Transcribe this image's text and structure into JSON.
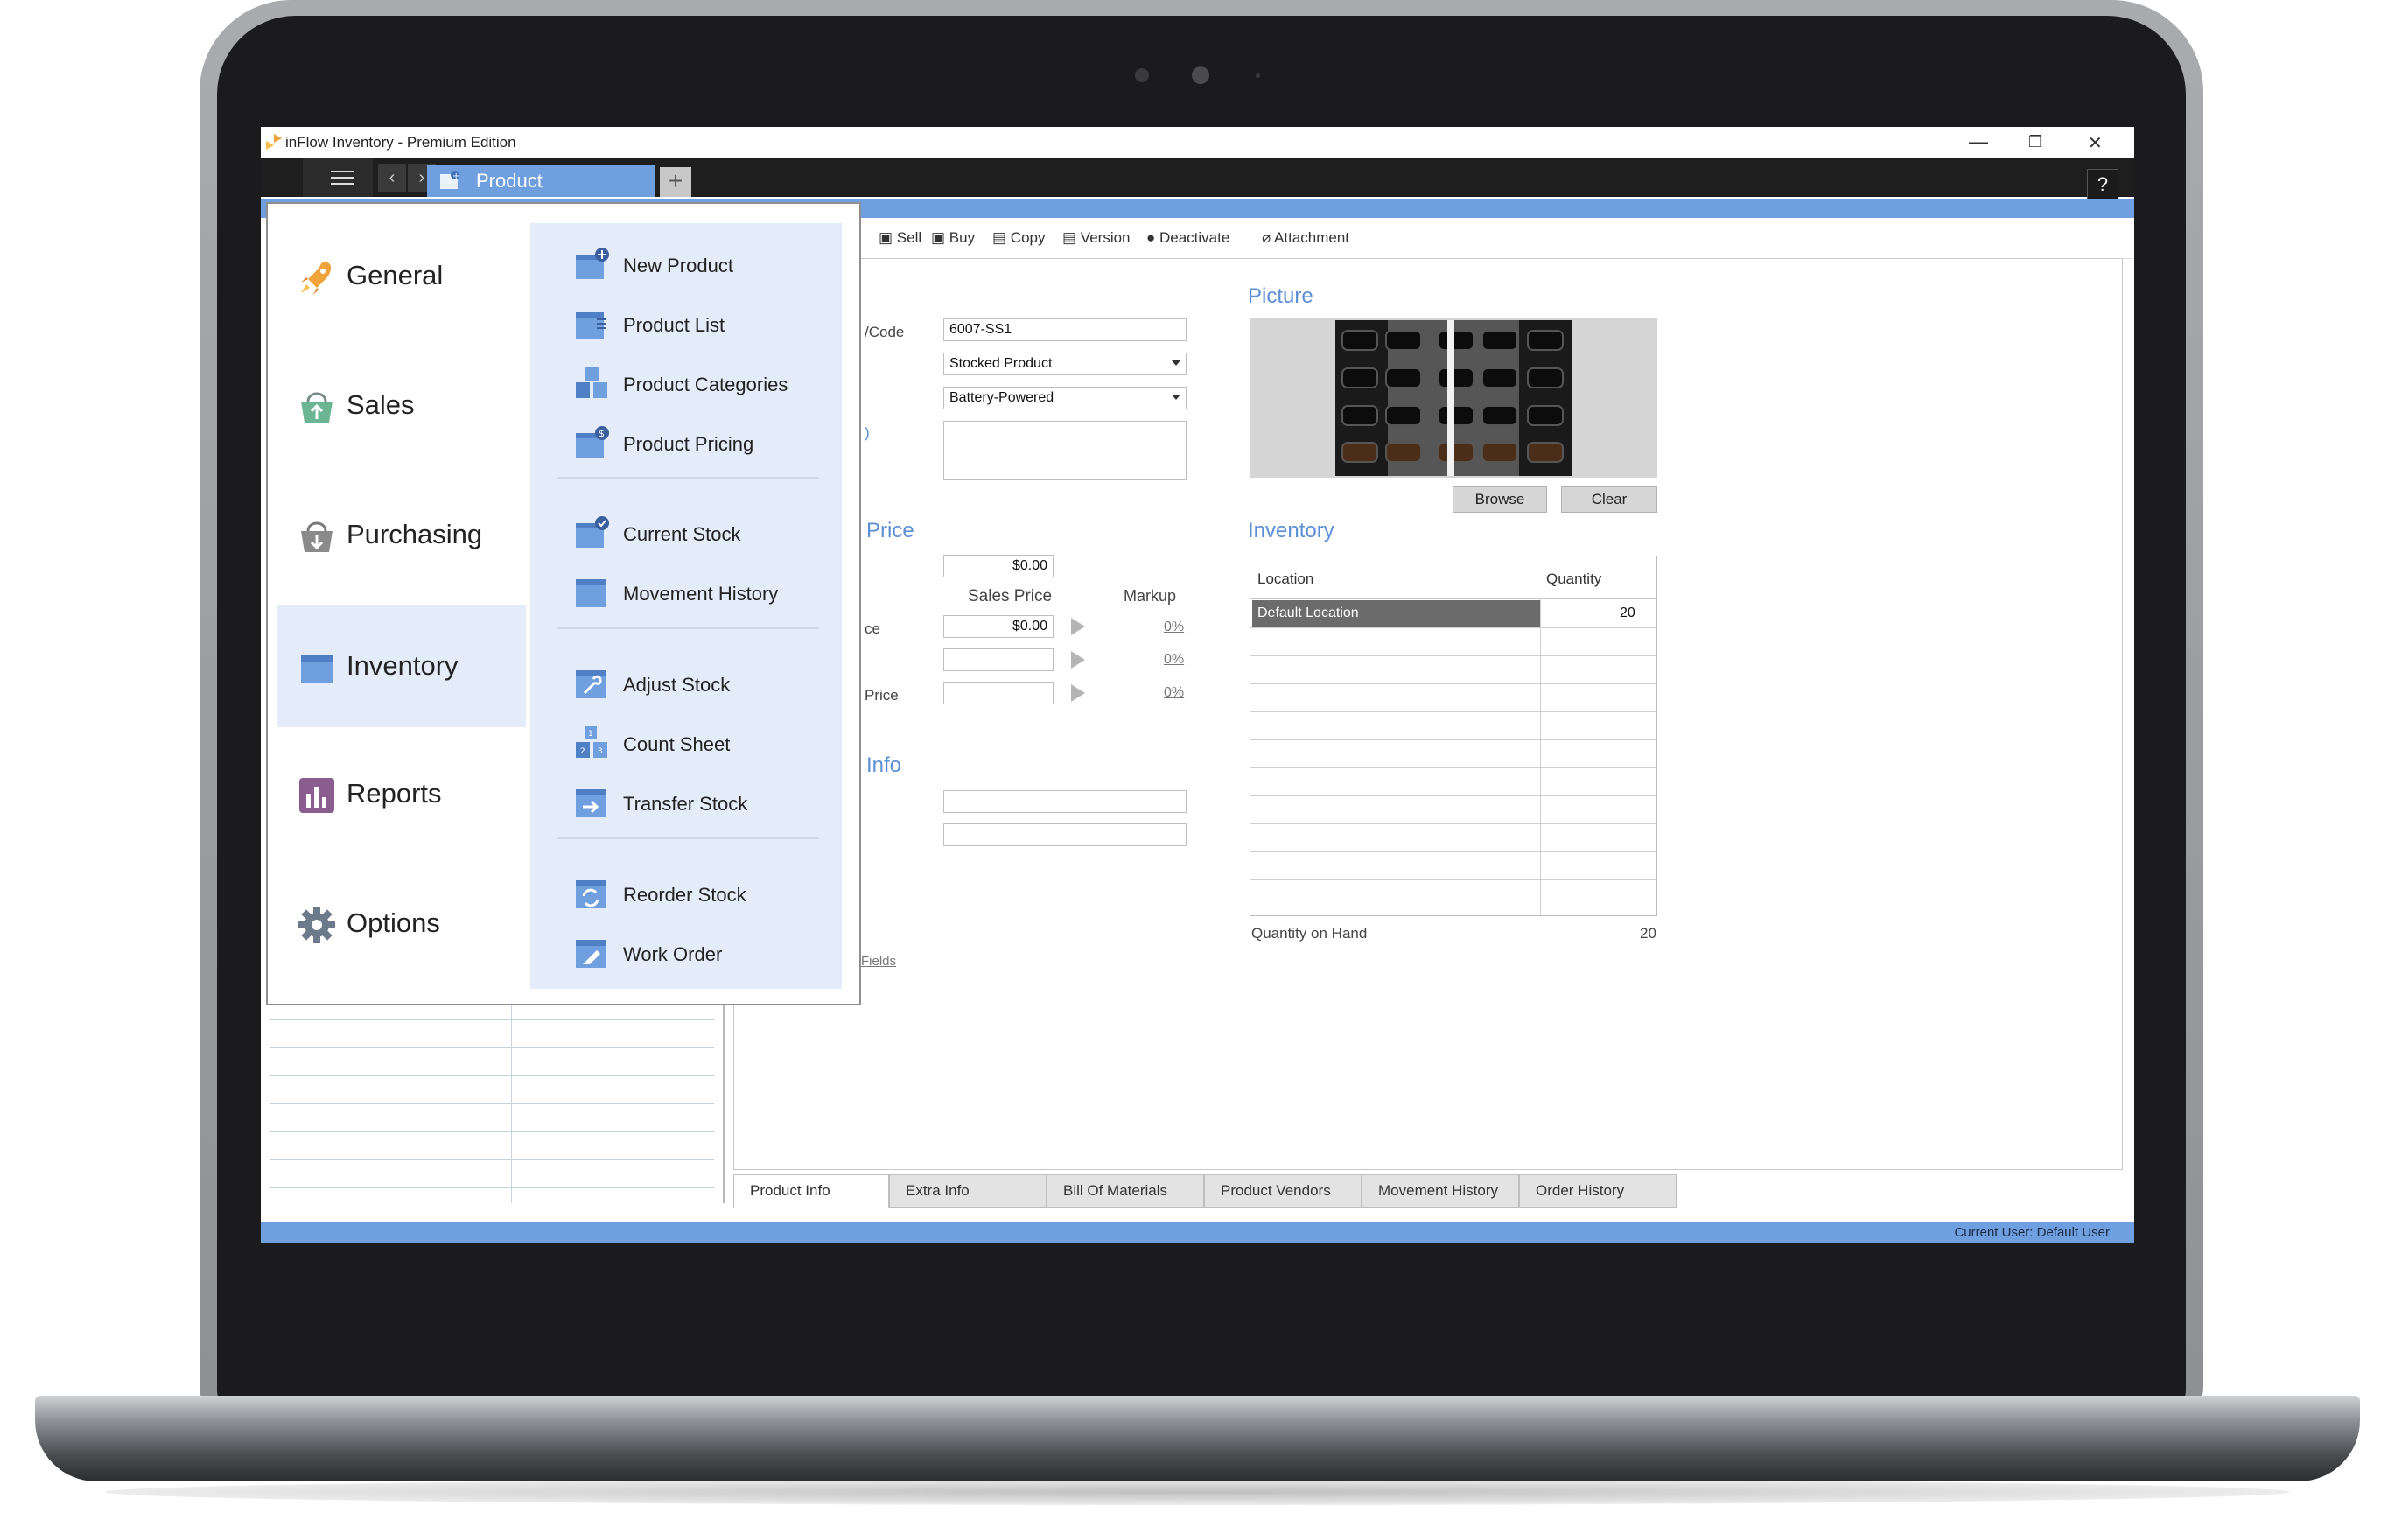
{
  "window": {
    "title": "inFlow Inventory - Premium Edition",
    "minimize": "—",
    "restore": "❐",
    "close": "✕"
  },
  "tabs": {
    "active_tab": "Product",
    "add_tab": "+",
    "help": "?",
    "back": "‹",
    "forward": "›"
  },
  "toolbar": {
    "items": [
      "Sell",
      "Buy",
      "Copy",
      "Version",
      "Deactivate",
      "Attachment"
    ]
  },
  "menu": {
    "categories": [
      {
        "label": "General",
        "icon": "rocket-icon",
        "color": "#f0a33a"
      },
      {
        "label": "Sales",
        "icon": "basket-up-icon",
        "color": "#6bb592"
      },
      {
        "label": "Purchasing",
        "icon": "basket-down-icon",
        "color": "#8a8a8a"
      },
      {
        "label": "Inventory",
        "icon": "box-icon",
        "color": "#6f9fde"
      },
      {
        "label": "Reports",
        "icon": "bar-chart-icon",
        "color": "#8b5c8f"
      },
      {
        "label": "Options",
        "icon": "gear-icon",
        "color": "#6c7a8c"
      }
    ],
    "active_category": "Inventory",
    "items": [
      {
        "label": "New Product",
        "icon": "new-product-icon"
      },
      {
        "label": "Product List",
        "icon": "product-list-icon"
      },
      {
        "label": "Product Categories",
        "icon": "product-categories-icon"
      },
      {
        "label": "Product Pricing",
        "icon": "product-pricing-icon"
      },
      {
        "label": "Current Stock",
        "icon": "current-stock-icon"
      },
      {
        "label": "Movement History",
        "icon": "movement-history-icon"
      },
      {
        "label": "Adjust Stock",
        "icon": "adjust-stock-icon"
      },
      {
        "label": "Count Sheet",
        "icon": "count-sheet-icon"
      },
      {
        "label": "Transfer Stock",
        "icon": "transfer-stock-icon"
      },
      {
        "label": "Reorder Stock",
        "icon": "reorder-stock-icon"
      },
      {
        "label": "Work Order",
        "icon": "work-order-icon"
      }
    ]
  },
  "form": {
    "code_label": "/Code",
    "code_value": "6007-SS1",
    "type_value": "Stocked Product",
    "category_value": "Battery-Powered",
    "price_section": "Price",
    "cost_value": "$0.00",
    "sales_price_header": "Sales Price",
    "markup_header": "Markup",
    "row1_label": "ce",
    "row1_price": "$0.00",
    "row1_markup": "0%",
    "row2_markup": "0%",
    "row3_label": "Price",
    "row3_markup": "0%",
    "info_section": "Info",
    "fields_link": "Fields"
  },
  "picture": {
    "title": "Picture",
    "browse": "Browse",
    "clear": "Clear"
  },
  "inventory": {
    "title": "Inventory",
    "col_location": "Location",
    "col_quantity": "Quantity",
    "rows": [
      {
        "location": "Default Location",
        "quantity": "20"
      }
    ],
    "qoh_label": "Quantity on Hand",
    "qoh_value": "20"
  },
  "bottom_tabs": [
    "Product Info",
    "Extra Info",
    "Bill Of Materials",
    "Product Vendors",
    "Movement History",
    "Order History"
  ],
  "status": {
    "text": "Current User:  Default User"
  },
  "colors": {
    "accent": "#6f9fde",
    "section_title": "#5b8fd6",
    "menu_bg": "#e3ecf8"
  }
}
